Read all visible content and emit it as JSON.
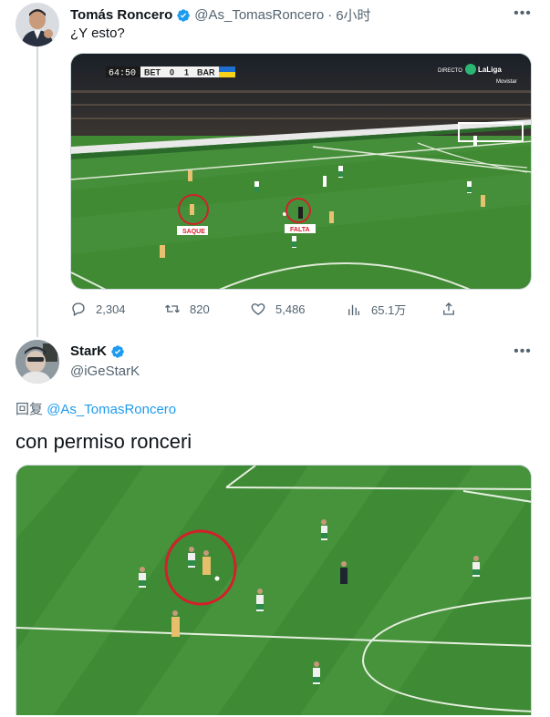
{
  "tweet1": {
    "author_name": "Tomás Roncero",
    "handle": "@As_TomasRoncero",
    "separator": "·",
    "time": "6小时",
    "text": "¿Y esto?",
    "scoreboard": {
      "time": "64:50",
      "home": "BET",
      "home_score": "0",
      "away_score": "1",
      "away": "BAR"
    },
    "broadcast": {
      "directo": "DIRECTO",
      "league": "LaLiga",
      "network": "Movistar"
    },
    "labels": {
      "saque": "SAQUE",
      "falta": "FALTA"
    },
    "actions": {
      "replies": "2,304",
      "retweets": "820",
      "likes": "5,486",
      "views": "65.1万"
    }
  },
  "tweet2": {
    "author_name": "StarK",
    "handle": "@iGeStarK",
    "reply_prefix": "回复",
    "reply_to": "@As_TomasRoncero",
    "text": "con permiso ronceri"
  },
  "colors": {
    "verified": "#1d9bf0",
    "pitch": "#3d8a34",
    "highlight_circle": "#d2202a"
  }
}
